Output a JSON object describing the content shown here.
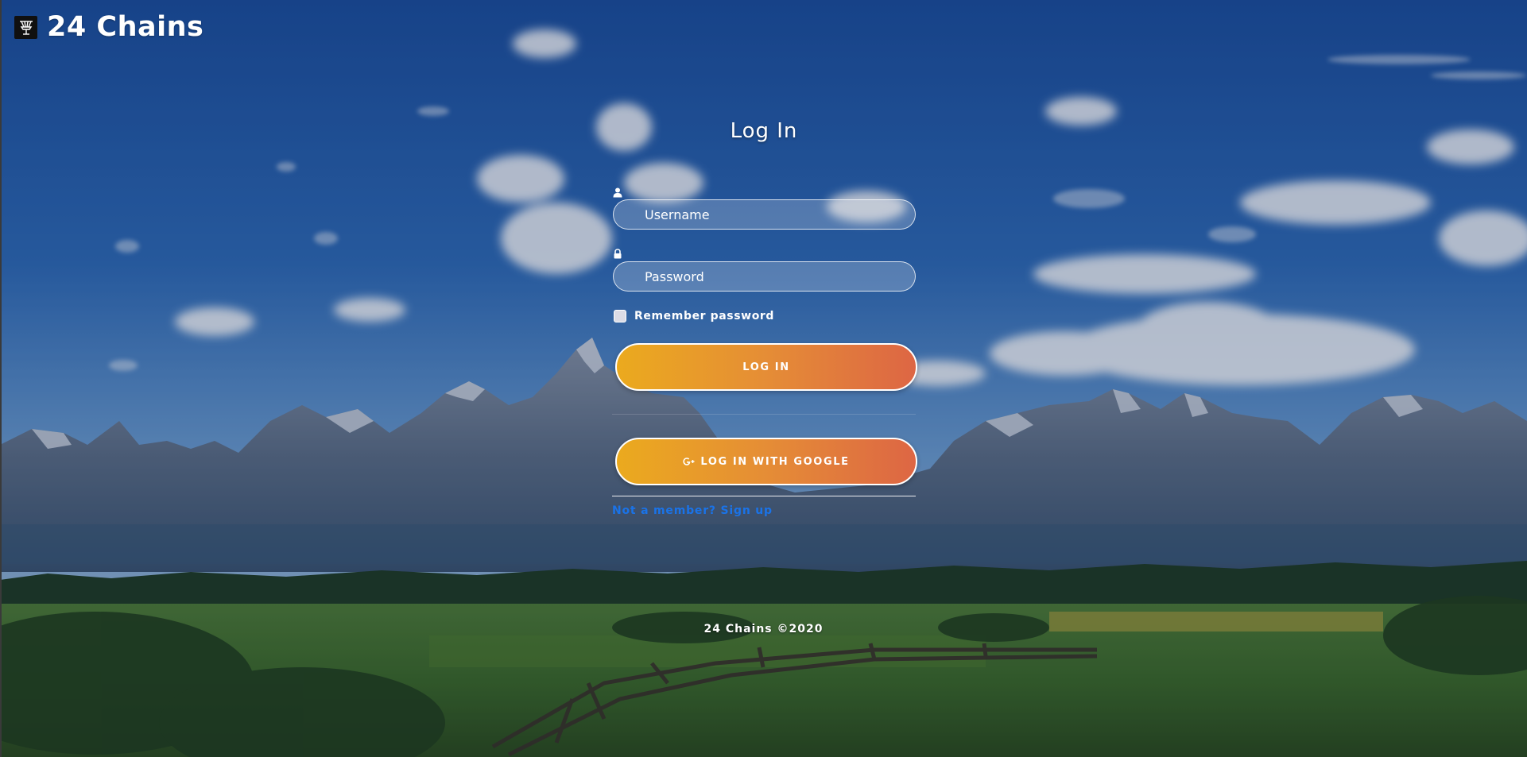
{
  "brand": {
    "name": "24 Chains",
    "logo_icon": "disc-golf-basket-icon"
  },
  "login": {
    "title": "Log In",
    "username": {
      "icon": "user-icon",
      "placeholder": "Username",
      "value": ""
    },
    "password": {
      "icon": "lock-icon",
      "placeholder": "Password",
      "value": ""
    },
    "remember_label": "Remember password",
    "remember_checked": false,
    "login_button": "LOG IN",
    "google_button": "LOG IN WITH GOOGLE",
    "google_icon": "google-plus-icon",
    "signup_link": "Not a member? Sign up"
  },
  "footer": {
    "text": "24 Chains ©2020"
  },
  "colors": {
    "button_gradient_start": "#ebaa1e",
    "button_gradient_end": "#dd6644",
    "link": "#1a73e8",
    "sky": "#2d6bb8"
  }
}
